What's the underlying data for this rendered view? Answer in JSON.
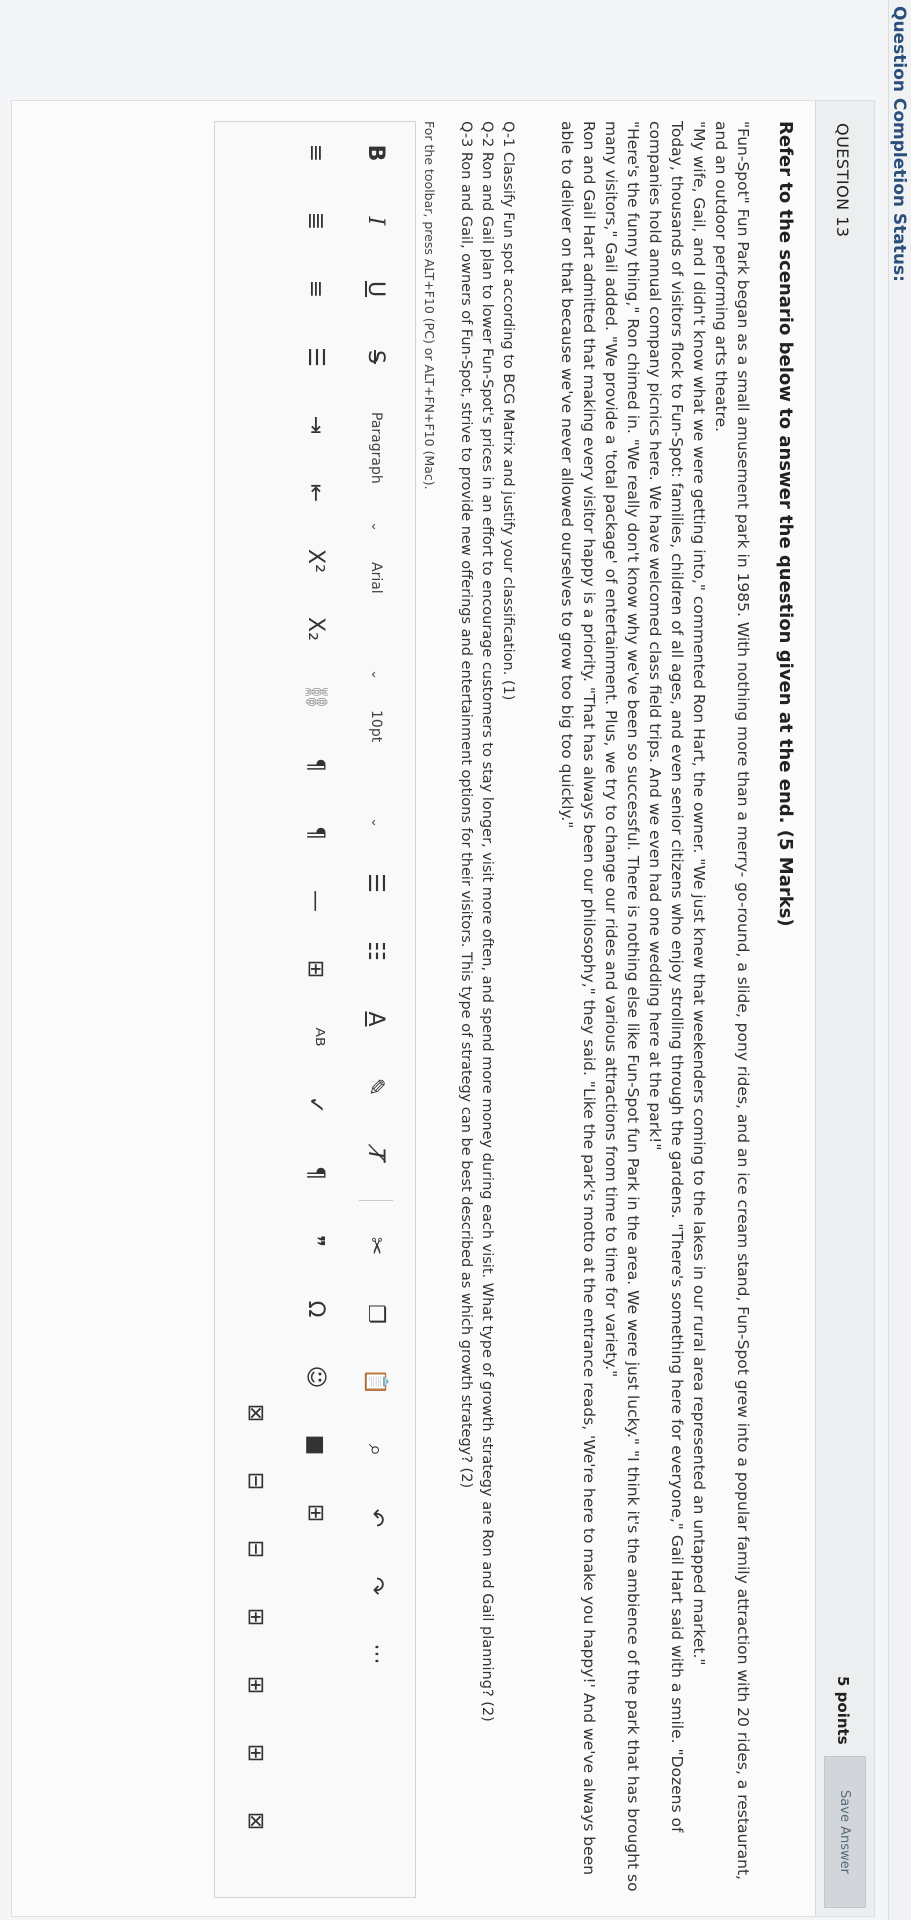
{
  "status_label": "Question Completion Status:",
  "question": {
    "number": "QUESTION 13",
    "points": "5 points",
    "save_label": "Save Answer",
    "instruction": "Refer to the scenario below to answer the question given at the end. (5 Marks)",
    "paragraphs": [
      "\"Fun-Spot\" Fun Park began as a small amusement park in 1985. With nothing more than a merry- go-round, a slide, pony rides, and an ice cream stand, Fun-Spot grew into a popular family attraction with 20 rides, a restaurant, and an outdoor performing arts theatre.",
      "\"My wife, Gail, and I didn't know what we were getting into,\" commented Ron Hart, the owner. \"We just knew that weekenders coming to the lakes in our rural area represented an untapped market.\"",
      "Today, thousands of visitors flock to Fun-Spot: families, children of all ages, and even senior citizens who enjoy strolling through the gardens. \"There's something here for everyone,\" Gail Hart said with a smile. \"Dozens of companies hold annual company picnics here. We have welcomed class field trips. And we even had one wedding here at the park!\"",
      "\"Here's the funny thing,\" Ron chimed in. \"We really don't know why we've been so successful. There is nothing else like Fun-Spot fun Park in the area. We were just lucky.\" \"I think it's the ambience of the park that has brought so many visitors,\" Gail added. \"We provide a 'total package' of entertainment. Plus, we try to change our rides and various attractions from time to time for variety.\"",
      "Ron and Gail Hart admitted that making every visitor happy is a priority. \"That has always been our philosophy,\" they said. \"Like the park's motto at the entrance reads, 'We're here to make you happy!' And we've always been able to deliver on that because we've never allowed ourselves to grow too big too quickly.\""
    ],
    "sub_questions": [
      "Q-1 Classify Fun spot according to BCG Matrix and justify your classification. (1)",
      "Q-2 Ron and Gail plan to lower Fun-Spot's prices in an effort to encourage customers to stay longer, visit more often, and spend more money during each visit. What type of growth strategy are Ron and Gail planning? (2)",
      "Q-3 Ron and Gail, owners of Fun-Spot, strive to provide new offerings and entertainment options for their visitors. This type of strategy can be best described as which growth strategy? (2)"
    ],
    "toolbar_hint": "For the toolbar, press ALT+F10 (PC) or ALT+FN+F10 (Mac)."
  },
  "toolbar": {
    "bold": "B",
    "italic": "I",
    "underline": "U",
    "strikethrough": "S",
    "paragraph": "Paragraph",
    "font": "Arial",
    "size": "10pt",
    "superscript": "X²",
    "subscript": "X₂",
    "more": "···",
    "caret": "⌄"
  }
}
